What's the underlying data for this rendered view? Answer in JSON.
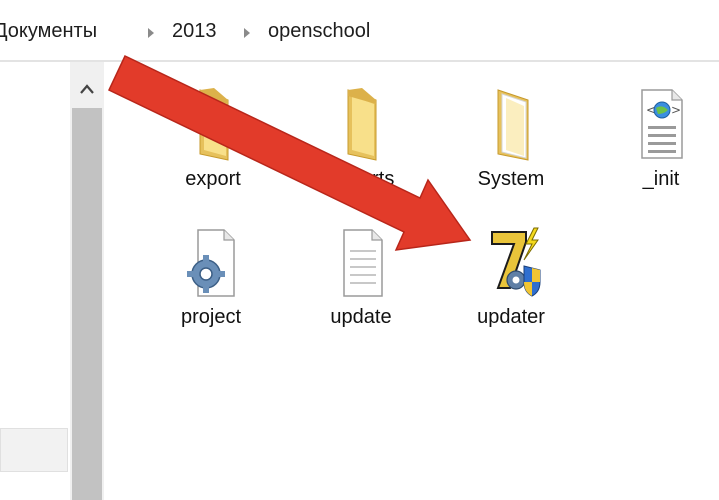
{
  "breadcrumb": {
    "items": [
      "Документы",
      "2013",
      "openschool"
    ]
  },
  "scrollbar": {
    "up_arrow": "^"
  },
  "files": [
    {
      "name": "export",
      "icon": "folder-icon"
    },
    {
      "name": "Imports",
      "icon": "folder-icon"
    },
    {
      "name": "System",
      "icon": "folder-icon"
    },
    {
      "name": "_init",
      "icon": "web-document-icon"
    },
    {
      "name": "project",
      "icon": "config-file-icon"
    },
    {
      "name": "update",
      "icon": "text-file-icon"
    },
    {
      "name": "updater",
      "icon": "7z-sfx-icon"
    }
  ],
  "annotation": {
    "arrow_color": "#e23b2a"
  }
}
